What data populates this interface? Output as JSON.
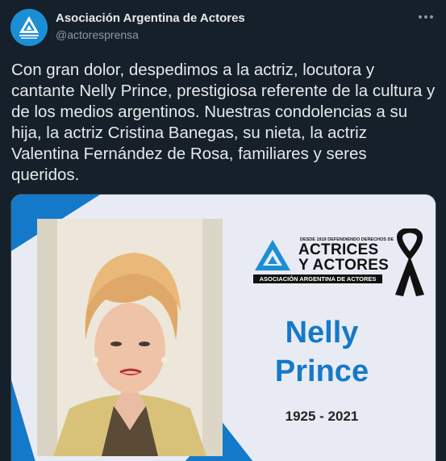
{
  "account": {
    "name": "Asociación Argentina de Actores",
    "handle": "@actoresprensa",
    "logo_text": "ASOCIACIÓN ARGENTINA DE ACTORES"
  },
  "tweet": {
    "text": "Con gran dolor, despedimos a la actriz, locutora y cantante Nelly Prince, prestigiosa referente de la cultura y de los medios argentinos. Nuestras condolencias a su hija, la actriz Cristina Banegas, su nieta, la actriz Valentina Fernández de Rosa, familiares y seres queridos."
  },
  "card": {
    "tagline": "DESDE 1919 DEFENDIENDO DERECHOS DE",
    "org_line1": "ACTRICES",
    "org_line2": "Y ACTORES",
    "org_bar": "ASOCIACIÓN ARGENTINA DE ACTORES",
    "first_name": "Nelly",
    "last_name": "Prince",
    "years": "1925 - 2021"
  },
  "colors": {
    "background": "#15202b",
    "brand_blue": "#1479c9",
    "card_background": "#e9ebf4"
  },
  "icons": {
    "more": "more-horizontal-icon",
    "mourning": "mourning-ribbon-icon"
  }
}
